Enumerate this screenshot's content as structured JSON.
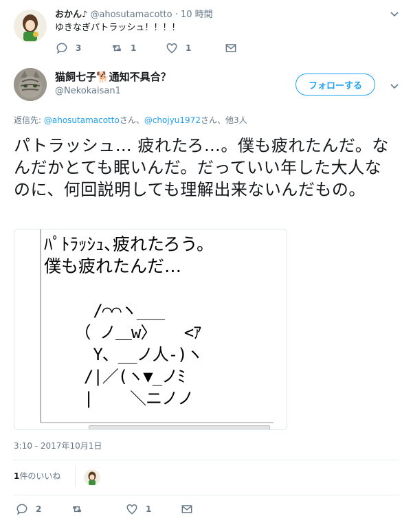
{
  "reply_tweet": {
    "display_name": "おかん♪",
    "handle": "@ahosutamacotto",
    "time": "10 時間",
    "text": "ゆきなぎパトラッシュ！！！！",
    "counts": {
      "replies": "3",
      "retweets": "1",
      "likes": "1"
    }
  },
  "main_tweet": {
    "display_name": "猫飼七子🐕通知不具合？",
    "handle": "@Nekokaisan1",
    "follow_label": "フォローする",
    "reply_to": {
      "prefix": "返信先: ",
      "user1": "@ahosutamacotto",
      "sep1": "さん、",
      "user2": "@chojyu1972",
      "sep2": "さん、他3人"
    },
    "text": "パトラッシュ… 疲れたろ…。僕も疲れたんだ。なんだかとても眠いんだ。だっていい年した大人なのに、何回説明しても理解出来ないんだもの。",
    "image": {
      "line1": "ﾊﾟﾄﾗｯｼｭ､疲れたろう。",
      "line2": "僕も疲れたんだ…",
      "art": "   /⌒⌒ヽ___\n （ ノ＿w〉   <ｱ\n   Y、__ノ人-)ヽ\n  /|／(ヽ▼_ノﾐ\n  |    ＼ニノノ"
    },
    "timestamp": "3:10 - 2017年10月1日",
    "likes_summary_count": "1",
    "likes_summary_label": "件のいいね",
    "counts": {
      "replies": "2",
      "retweets": "",
      "likes": "1"
    }
  },
  "colors": {
    "accent": "#1da1f2",
    "muted": "#657786",
    "divider": "#e6ecf0"
  }
}
